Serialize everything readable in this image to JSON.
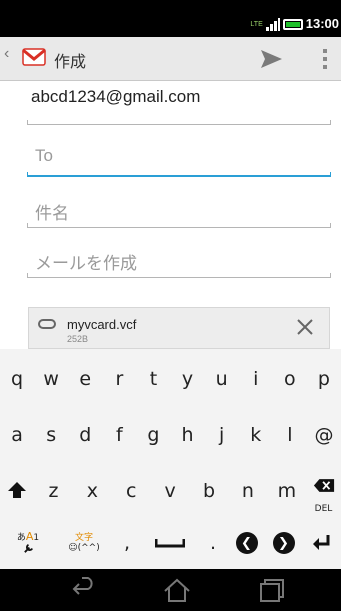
{
  "status_bar": {
    "network": "LTE",
    "time": "13:00"
  },
  "action_bar": {
    "title": "作成",
    "logo": "gmail-envelope-icon",
    "send": "send-icon",
    "menu": "overflow-menu-icon"
  },
  "compose": {
    "from_account": "abcd1234@gmail.com",
    "to_placeholder": "To",
    "subject_placeholder": "件名",
    "body_placeholder": "メールを作成"
  },
  "attachment": {
    "name": "myvcard.vcf",
    "size": "252B"
  },
  "keyboard": {
    "row1": [
      "q",
      "w",
      "e",
      "r",
      "t",
      "y",
      "u",
      "i",
      "o",
      "p"
    ],
    "row2": [
      "a",
      "s",
      "d",
      "f",
      "g",
      "h",
      "j",
      "k",
      "l",
      "@"
    ],
    "row3": [
      "z",
      "x",
      "c",
      "v",
      "b",
      "n",
      "m"
    ],
    "del_label": "DEL",
    "mode_a": "あ",
    "mode_A": "A",
    "mode_1": "1",
    "moji_label": "文字",
    "emoji_label": "☺(^^)",
    "comma": ",",
    "period": "."
  },
  "colors": {
    "accent": "#2a9fd6",
    "gmail_red": "#d93025",
    "battery": "#1fbf2a"
  }
}
